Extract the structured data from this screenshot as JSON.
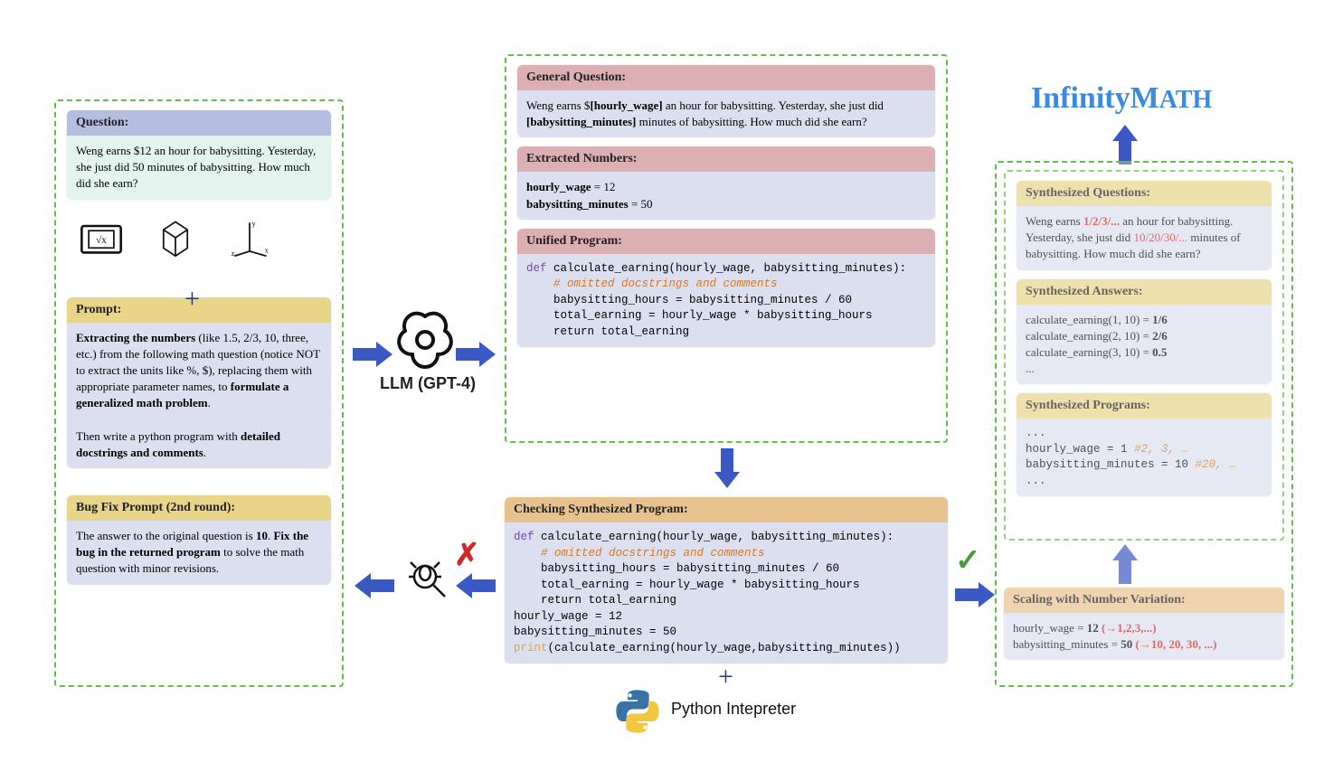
{
  "title": "InfinityMATH",
  "llm_label": "LLM (GPT-4)",
  "python_label": "Python Intepreter",
  "left": {
    "question": {
      "header": "Question:",
      "body": "Weng earns $12 an hour for babysitting. Yesterday, she just did 50 minutes of babysitting. How much did she earn?"
    },
    "prompt": {
      "header": "Prompt:",
      "body_html": "<b>Extracting the numbers</b> (like 1.5, 2/3, 10, three, etc.) from the following math question (notice NOT to extract the units like %, $), replacing them with appropriate parameter names, to <b>formulate a generalized math problem</b>.<br><br>Then write a python program with <b>detailed docstrings and comments</b>."
    },
    "bugfix": {
      "header": "Bug Fix Prompt (2nd round):",
      "body_html": "The answer to the original question is <b>10</b>. <b>Fix the bug in the returned program</b> to solve the math question with minor revisions."
    }
  },
  "center": {
    "general_q": {
      "header": "General Question:",
      "body_html": "Weng earns $<b>[hourly_wage]</b> an hour for babysitting. Yesterday, she just did <b>[babysitting_minutes]</b> minutes of babysitting. How much did she earn?"
    },
    "extracted": {
      "header": "Extracted Numbers:",
      "body_html": "<b>hourly_wage</b> = 12<br><b>babysitting_minutes</b> = 50"
    },
    "unified": {
      "header": "Unified Program:",
      "code_lines": [
        {
          "def": "def ",
          "rest": "calculate_earning(hourly_wage, babysitting_minutes):"
        },
        {
          "cmt": "    # omitted docstrings and comments"
        },
        {
          "plain": "    babysitting_hours = babysitting_minutes / 60"
        },
        {
          "plain": "    total_earning = hourly_wage * babysitting_hours"
        },
        {
          "plain": "    return total_earning"
        }
      ]
    },
    "checking": {
      "header": "Checking Synthesized Program:",
      "code_lines": [
        {
          "def": "def ",
          "rest": "calculate_earning(hourly_wage, babysitting_minutes):"
        },
        {
          "cmt": "    # omitted docstrings and comments"
        },
        {
          "plain": "    babysitting_hours = babysitting_minutes / 60"
        },
        {
          "plain": "    total_earning = hourly_wage * babysitting_hours"
        },
        {
          "plain": "    return total_earning"
        },
        {
          "plain": "hourly_wage = 12"
        },
        {
          "plain": "babysitting_minutes = 50"
        },
        {
          "print": "print",
          "rest2": "(calculate_earning(hourly_wage,babysitting_minutes))"
        }
      ]
    }
  },
  "right": {
    "synth_q": {
      "header": "Synthesized Questions:",
      "body_html": "Weng earns <span class='red bold'>1/2/3/...</span> an hour for babysitting. Yesterday, she just did <span class='red'>10/20/30/...</span> minutes of babysitting. How much did she earn?"
    },
    "synth_a": {
      "header": "Synthesized Answers:",
      "body_html": "calculate_earning(1, 10) = <b>1/6</b><br>calculate_earning(2, 10) = <b>2/6</b><br>calculate_earning(3, 10) = <b>0.5</b><br>..."
    },
    "synth_p": {
      "header": "Synthesized Programs:",
      "body_html": "...<br>hourly_wage = 1 <span class='kw-cmt'>#2, 3, …</span><br>babysitting_minutes = 10 <span class='kw-cmt'>#20, …</span><br>..."
    },
    "scaling": {
      "header": "Scaling with Number Variation:",
      "body_html": "hourly_wage = <b>12</b> <span class='red bold'>(→1,2,3,...)</span><br>babysitting_minutes = <b>50</b> <span class='red bold'>(→10, 20, 30, ...)</span>"
    }
  }
}
